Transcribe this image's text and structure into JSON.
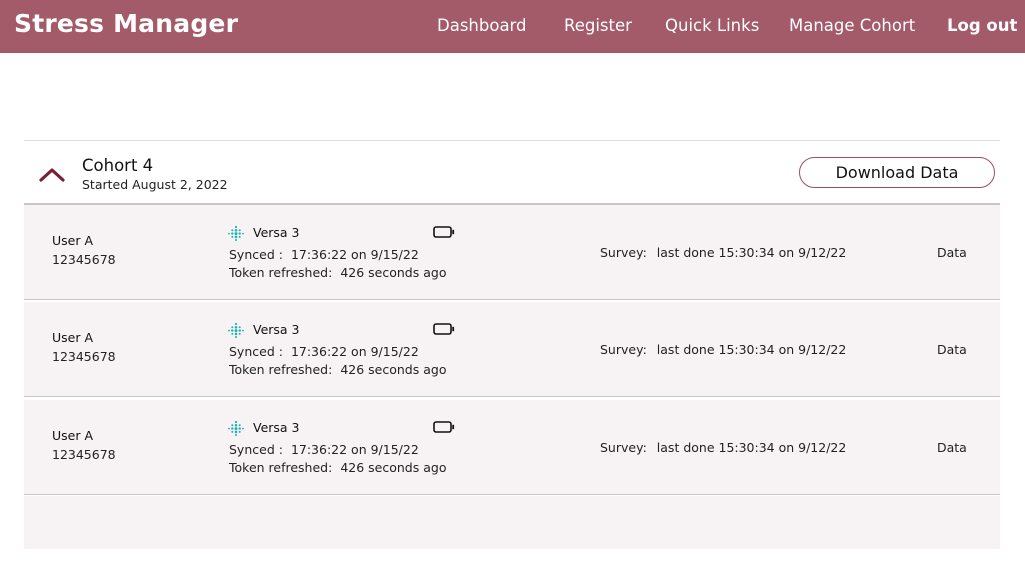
{
  "app": {
    "title": "Stress Manager"
  },
  "nav": {
    "dashboard": "Dashboard",
    "register": "Register",
    "quick_links": "Quick Links",
    "manage_cohort": "Manage Cohort",
    "logout": "Log out"
  },
  "colors": {
    "brand": "#a35a69",
    "accent_dark": "#7a1f35",
    "device_teal": "#1fb3b3"
  },
  "cohort": {
    "title": "Cohort 4",
    "started": "Started August 2, 2022",
    "download_label": "Download Data",
    "icons": {
      "collapse": "chevron-up-icon",
      "device": "fitbit-icon",
      "battery": "battery-icon"
    }
  },
  "rows": [
    {
      "user_name": "User A",
      "user_id": "12345678",
      "device": "Versa 3",
      "synced_label": "Synced :",
      "synced_value": "17:36:22 on 9/15/22",
      "token_label": "Token refreshed:",
      "token_value": "426 seconds ago",
      "survey_label": "Survey:",
      "survey_value": "last done 15:30:34 on 9/12/22",
      "data_label": "Data"
    },
    {
      "user_name": "User A",
      "user_id": "12345678",
      "device": "Versa 3",
      "synced_label": "Synced :",
      "synced_value": "17:36:22 on 9/15/22",
      "token_label": "Token refreshed:",
      "token_value": "426 seconds ago",
      "survey_label": "Survey:",
      "survey_value": "last done 15:30:34 on 9/12/22",
      "data_label": "Data"
    },
    {
      "user_name": "User A",
      "user_id": "12345678",
      "device": "Versa 3",
      "synced_label": "Synced :",
      "synced_value": "17:36:22 on 9/15/22",
      "token_label": "Token refreshed:",
      "token_value": "426 seconds ago",
      "survey_label": "Survey:",
      "survey_value": "last done 15:30:34 on 9/12/22",
      "data_label": "Data"
    }
  ]
}
